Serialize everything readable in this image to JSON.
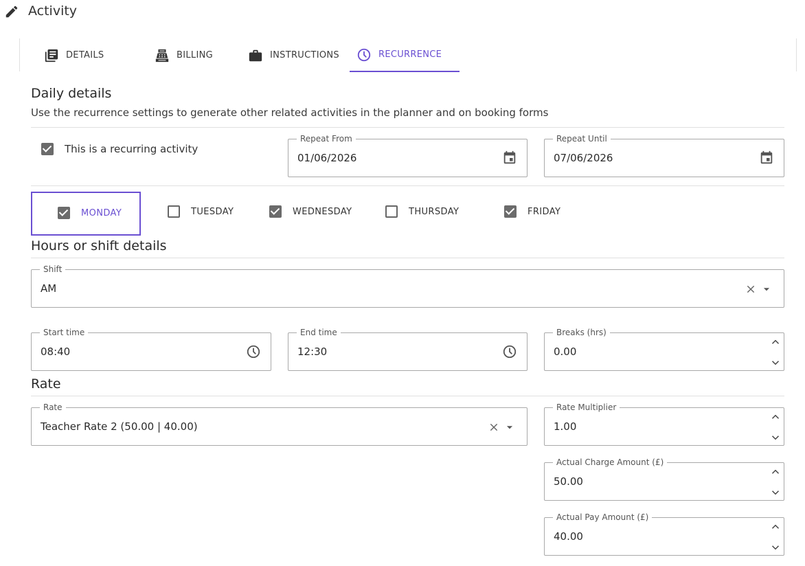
{
  "header": {
    "title": "Activity",
    "icon": "pencil-icon"
  },
  "tabs": [
    {
      "label": "DETAILS",
      "icon": "document-list-icon",
      "active": false
    },
    {
      "label": "BILLING",
      "icon": "cash-register-icon",
      "active": false
    },
    {
      "label": "INSTRUCTIONS",
      "icon": "briefcase-icon",
      "active": false
    },
    {
      "label": "RECURRENCE",
      "icon": "clock-icon",
      "active": true
    }
  ],
  "daily": {
    "heading": "Daily details",
    "subtext": "Use the recurrence settings to generate other related activities in the planner and on booking forms",
    "recurring_label": "This is a recurring activity",
    "recurring_checked": true,
    "repeat_from": {
      "label": "Repeat From",
      "value": "01/06/2026"
    },
    "repeat_until": {
      "label": "Repeat Until",
      "value": "07/06/2026"
    },
    "days": [
      {
        "label": "MONDAY",
        "checked": true,
        "focused": true
      },
      {
        "label": "TUESDAY",
        "checked": false
      },
      {
        "label": "WEDNESDAY",
        "checked": true
      },
      {
        "label": "THURSDAY",
        "checked": false
      },
      {
        "label": "FRIDAY",
        "checked": true
      }
    ]
  },
  "hours": {
    "heading": "Hours or shift details",
    "shift": {
      "label": "Shift",
      "value": "AM"
    },
    "start_time": {
      "label": "Start time",
      "value": "08:40"
    },
    "end_time": {
      "label": "End time",
      "value": "12:30"
    },
    "breaks": {
      "label": "Breaks (hrs)",
      "value": "0.00"
    }
  },
  "rate": {
    "heading": "Rate",
    "rate": {
      "label": "Rate",
      "value": "Teacher Rate 2 (50.00 | 40.00)"
    },
    "multiplier": {
      "label": "Rate Multiplier",
      "value": "1.00"
    },
    "charge": {
      "label": "Actual Charge Amount (£)",
      "value": "50.00"
    },
    "pay": {
      "label": "Actual Pay Amount (£)",
      "value": "40.00"
    }
  },
  "colors": {
    "accent": "#6a4fd2",
    "checkbox": "#6b6b6b",
    "border": "#a9a9a9"
  }
}
